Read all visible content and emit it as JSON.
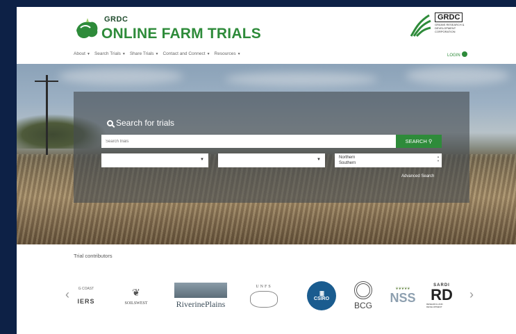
{
  "header": {
    "logo_small": "GRDC",
    "logo_title": "ONLINE FARM TRIALS",
    "partner_name": "GRDC",
    "partner_sub": "GRAINS RESEARCH & DEVELOPMENT CORPORATION",
    "login": "LOGIN"
  },
  "nav": {
    "items": [
      {
        "label": "About"
      },
      {
        "label": "Search Trials"
      },
      {
        "label": "Share Trials"
      },
      {
        "label": "Contact and Connect"
      },
      {
        "label": "Resources"
      }
    ]
  },
  "search": {
    "title": "Search for trials",
    "placeholder": "Search trials",
    "button": "SEARCH",
    "region_options": [
      "Northern",
      "Southern"
    ],
    "advanced": "Advanced Search"
  },
  "contributors": {
    "title": "Trial contributors",
    "logos": {
      "gcoast_top": "G COAST",
      "gcoast_bottom": "IERS",
      "soilswest": "SOILSWEST",
      "riverine": "RiverinePlains",
      "unfs": "UNFS",
      "csiro": "CSIRO",
      "bcg": "BCG",
      "nss": "NSS",
      "sardi_top": "SARDI",
      "sardi_mark": "RD",
      "sardi_sub": "RESEARCH AND DEVELOPMENT"
    }
  },
  "colors": {
    "brand_green": "#2e8b3a",
    "frame_navy": "#0d2146"
  }
}
